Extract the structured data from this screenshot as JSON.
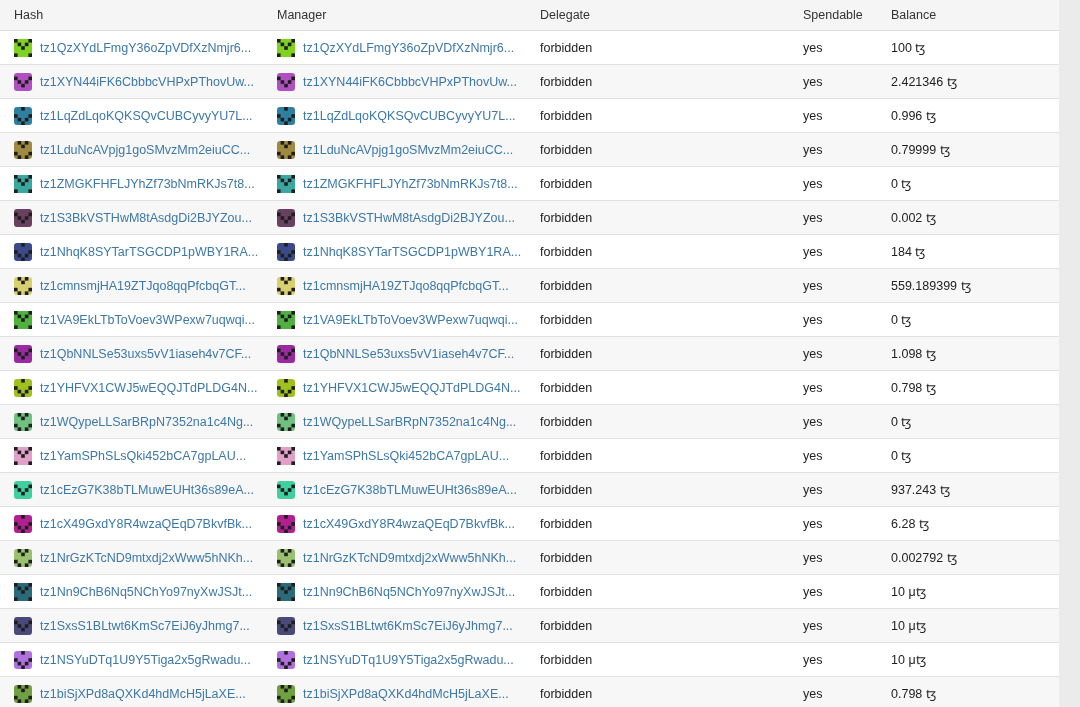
{
  "table": {
    "columns": [
      "Hash",
      "Manager",
      "Delegate",
      "Spendable",
      "Balance"
    ],
    "rows": [
      {
        "hash": "tz1QzXYdLFmgY36oZpVDfXzNmjr6...",
        "manager": "tz1QzXYdLFmgY36oZpVDfXzNmjr6...",
        "delegate": "forbidden",
        "spendable": "yes",
        "balance": "100 ꜩ",
        "color": "#7ed321"
      },
      {
        "hash": "tz1XYN44iFK6CbbbcVHPxPThovUw...",
        "manager": "tz1XYN44iFK6CbbbcVHPxPThovUw...",
        "delegate": "forbidden",
        "spendable": "yes",
        "balance": "2.421346 ꜩ",
        "color": "#b050c0"
      },
      {
        "hash": "tz1LqZdLqoKQKSQvCUBCyvyYU7L...",
        "manager": "tz1LqZdLqoKQKSQvCUBCyvyYU7L...",
        "delegate": "forbidden",
        "spendable": "yes",
        "balance": "0.996 ꜩ",
        "color": "#2f7fa0"
      },
      {
        "hash": "tz1LduNcAVpjg1goSMvzMm2eiuCC...",
        "manager": "tz1LduNcAVpjg1goSMvzMm2eiuCC...",
        "delegate": "forbidden",
        "spendable": "yes",
        "balance": "0.79999 ꜩ",
        "color": "#a08a40"
      },
      {
        "hash": "tz1ZMGKFHFLJYhZf73bNmRKJs7t8...",
        "manager": "tz1ZMGKFHFLJYhZf73bNmRKJs7t8...",
        "delegate": "forbidden",
        "spendable": "yes",
        "balance": "0 ꜩ",
        "color": "#3aa8a0"
      },
      {
        "hash": "tz1S3BkVSTHwM8tAsdgDi2BJYZou...",
        "manager": "tz1S3BkVSTHwM8tAsdgDi2BJYZou...",
        "delegate": "forbidden",
        "spendable": "yes",
        "balance": "0.002 ꜩ",
        "color": "#6a4060"
      },
      {
        "hash": "tz1NhqK8SYTarTSGCDP1pWBY1RA...",
        "manager": "tz1NhqK8SYTarTSGCDP1pWBY1RA...",
        "delegate": "forbidden",
        "spendable": "yes",
        "balance": "184 ꜩ",
        "color": "#3a4a8a"
      },
      {
        "hash": "tz1cmnsmjHA19ZTJqo8qqPfcbqGT...",
        "manager": "tz1cmnsmjHA19ZTJqo8qqPfcbqGT...",
        "delegate": "forbidden",
        "spendable": "yes",
        "balance": "559.189399 ꜩ",
        "color": "#d8d070"
      },
      {
        "hash": "tz1VA9EkLTbToVoev3WPexw7uqwqi...",
        "manager": "tz1VA9EkLTbToVoev3WPexw7uqwqi...",
        "delegate": "forbidden",
        "spendable": "yes",
        "balance": "0 ꜩ",
        "color": "#50b040"
      },
      {
        "hash": "tz1QbNNLSe53uxs5vV1iaseh4v7CF...",
        "manager": "tz1QbNNLSe53uxs5vV1iaseh4v7CF...",
        "delegate": "forbidden",
        "spendable": "yes",
        "balance": "1.098 ꜩ",
        "color": "#9a2aa0"
      },
      {
        "hash": "tz1YHFVX1CWJ5wEQQJTdPLDG4N...",
        "manager": "tz1YHFVX1CWJ5wEQQJTdPLDG4N...",
        "delegate": "forbidden",
        "spendable": "yes",
        "balance": "0.798 ꜩ",
        "color": "#a0c020"
      },
      {
        "hash": "tz1WQypeLLSarBRpN7352na1c4Ng...",
        "manager": "tz1WQypeLLSarBRpN7352na1c4Ng...",
        "delegate": "forbidden",
        "spendable": "yes",
        "balance": "0 ꜩ",
        "color": "#70c080"
      },
      {
        "hash": "tz1YamSPhSLsQki452bCA7gpLAU...",
        "manager": "tz1YamSPhSLsQki452bCA7gpLAU...",
        "delegate": "forbidden",
        "spendable": "yes",
        "balance": "0 ꜩ",
        "color": "#e0a0c8"
      },
      {
        "hash": "tz1cEzG7K38bTLMuwEUHt36s89eA...",
        "manager": "tz1cEzG7K38bTLMuwEUHt36s89eA...",
        "delegate": "forbidden",
        "spendable": "yes",
        "balance": "937.243 ꜩ",
        "color": "#40d0a0"
      },
      {
        "hash": "tz1cX49GxdY8R4wzaQEqD7BkvfBk...",
        "manager": "tz1cX49GxdY8R4wzaQEqD7BkvfBk...",
        "delegate": "forbidden",
        "spendable": "yes",
        "balance": "6.28 ꜩ",
        "color": "#b02090"
      },
      {
        "hash": "tz1NrGzKTcND9mtxdj2xWww5hNKh...",
        "manager": "tz1NrGzKTcND9mtxdj2xWww5hNKh...",
        "delegate": "forbidden",
        "spendable": "yes",
        "balance": "0.002792 ꜩ",
        "color": "#9ac070"
      },
      {
        "hash": "tz1Nn9ChB6Nq5NChYo97nyXwJSJt...",
        "manager": "tz1Nn9ChB6Nq5NChYo97nyXwJSJt...",
        "delegate": "forbidden",
        "spendable": "yes",
        "balance": "10 μꜩ",
        "color": "#2a6a7a"
      },
      {
        "hash": "tz1SxsS1BLtwt6KmSc7EiJ6yJhmg7...",
        "manager": "tz1SxsS1BLtwt6KmSc7EiJ6yJhmg7...",
        "delegate": "forbidden",
        "spendable": "yes",
        "balance": "10 μꜩ",
        "color": "#4a4a7a"
      },
      {
        "hash": "tz1NSYuDTq1U9Y5Tiga2x5gRwadu...",
        "manager": "tz1NSYuDTq1U9Y5Tiga2x5gRwadu...",
        "delegate": "forbidden",
        "spendable": "yes",
        "balance": "10 μꜩ",
        "color": "#b070e0"
      },
      {
        "hash": "tz1biSjXPd8aQXKd4hdMcH5jLaXE...",
        "manager": "tz1biSjXPd8aQXKd4hdMcH5jLaXE...",
        "delegate": "forbidden",
        "spendable": "yes",
        "balance": "0.798 ꜩ",
        "color": "#70a040"
      }
    ]
  }
}
